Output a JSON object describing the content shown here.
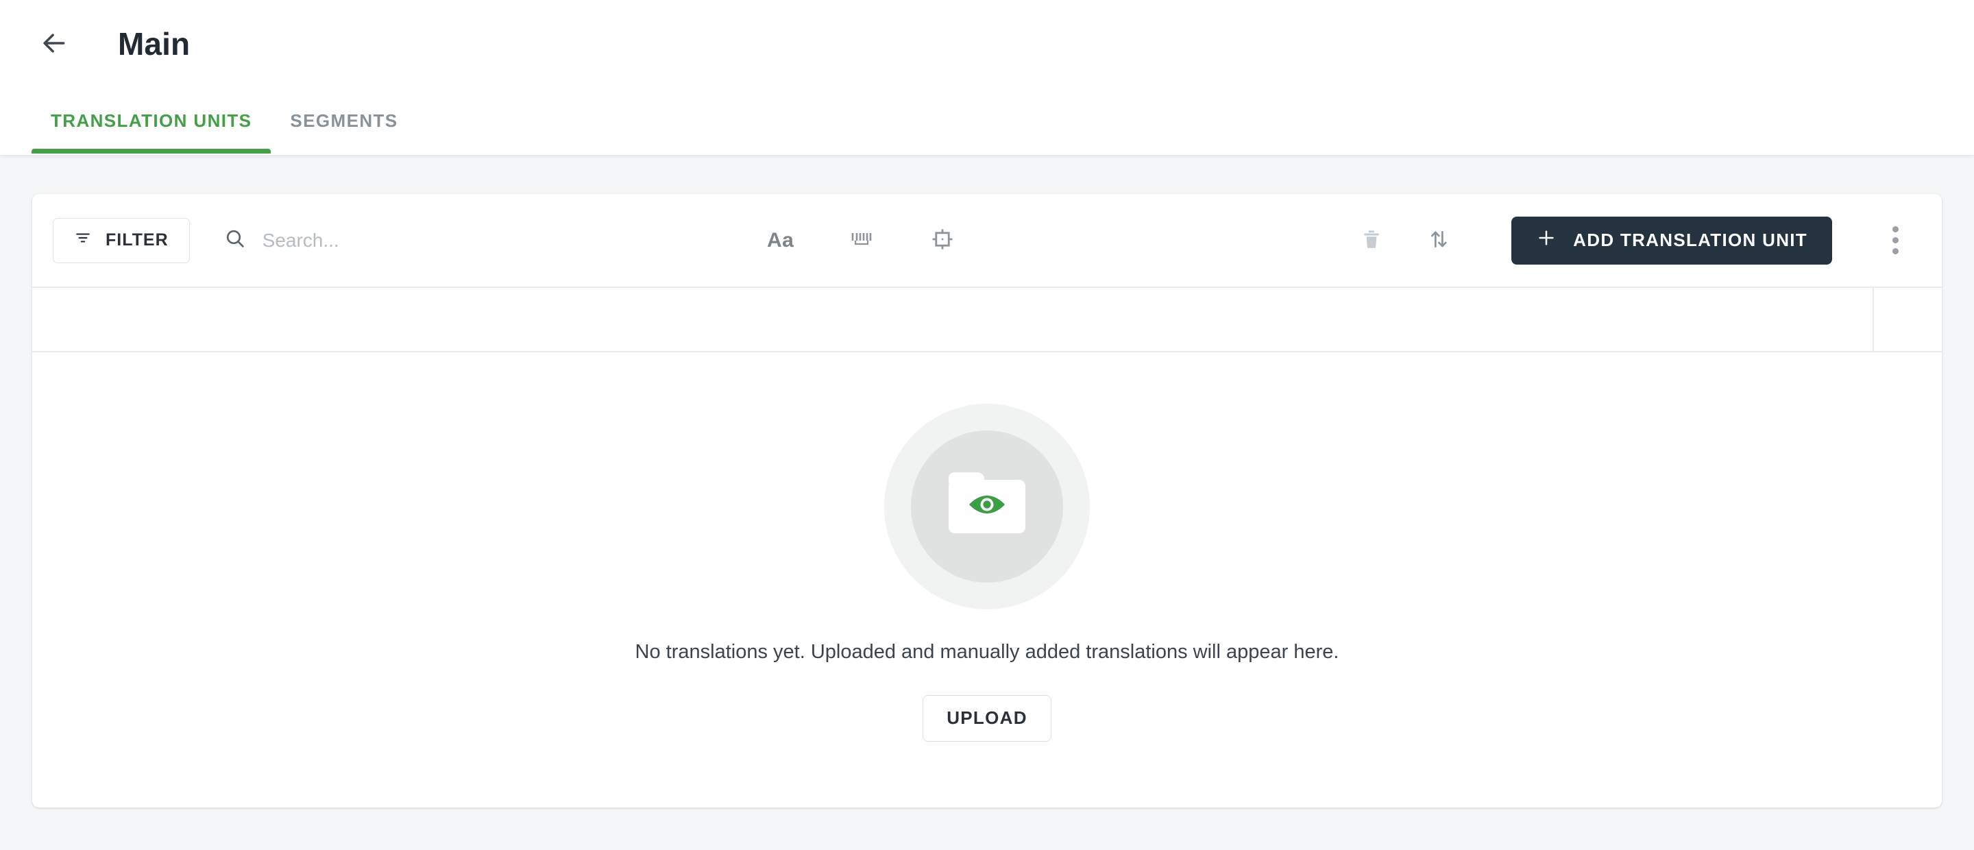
{
  "header": {
    "back_icon": "arrow-left-icon",
    "title": "Main",
    "tabs": [
      {
        "label": "TRANSLATION UNITS",
        "active": true
      },
      {
        "label": "SEGMENTS",
        "active": false
      }
    ]
  },
  "toolbar": {
    "filter_label": "FILTER",
    "filter_icon": "filter-icon",
    "search": {
      "icon": "search-icon",
      "value": "",
      "placeholder": "Search..."
    },
    "view_icons": [
      {
        "name": "text-case-icon",
        "label": "Aa"
      },
      {
        "name": "tags-icon",
        "label": ""
      },
      {
        "name": "crop-frame-icon",
        "label": ""
      }
    ],
    "delete_icon": "trash-icon",
    "sort_icon": "sort-arrows-icon",
    "add_button": {
      "label": "ADD TRANSLATION UNIT",
      "icon": "plus-icon"
    },
    "more_icon": "kebab-menu-icon"
  },
  "empty_state": {
    "illustration_icon": "folder-eye-icon",
    "message": "No translations yet. Uploaded and manually added translations will appear here.",
    "upload_label": "UPLOAD"
  },
  "colors": {
    "accent_green": "#43a047",
    "dark_button": "#253240",
    "page_background": "#f4f6f7",
    "muted_text": "#8a9299"
  }
}
